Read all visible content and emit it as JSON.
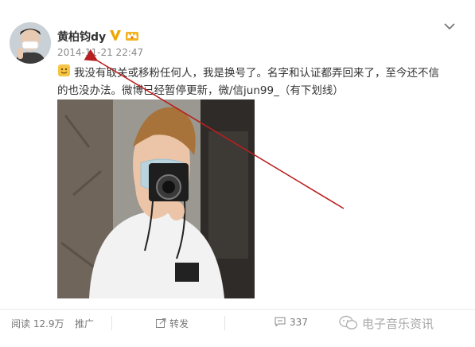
{
  "post": {
    "username": "黄柏钧dy",
    "timestamp": "2014-11-21 22:47",
    "text_line1": "我没有取关或移粉任何人，我是换号了。名字和认证都弄回来了，至今还不信",
    "text_line2": "的也没办法。微博已经暂停更新，微/信jun99_（有下划线）",
    "accent_color": "#e0a600",
    "arrow_color": "#b8201f"
  },
  "icons": {
    "verify": "verified-v-icon",
    "member": "vip-crown-icon",
    "emoji": "smile-emoji-icon",
    "more": "chevron-down-icon",
    "share": "share-icon",
    "comment": "comment-icon",
    "wechat": "wechat-icon"
  },
  "actions": {
    "reads": "阅读 12.9万",
    "promote": "推广",
    "repost": "转发",
    "comments": "337"
  },
  "watermark": "电子音乐资讯"
}
